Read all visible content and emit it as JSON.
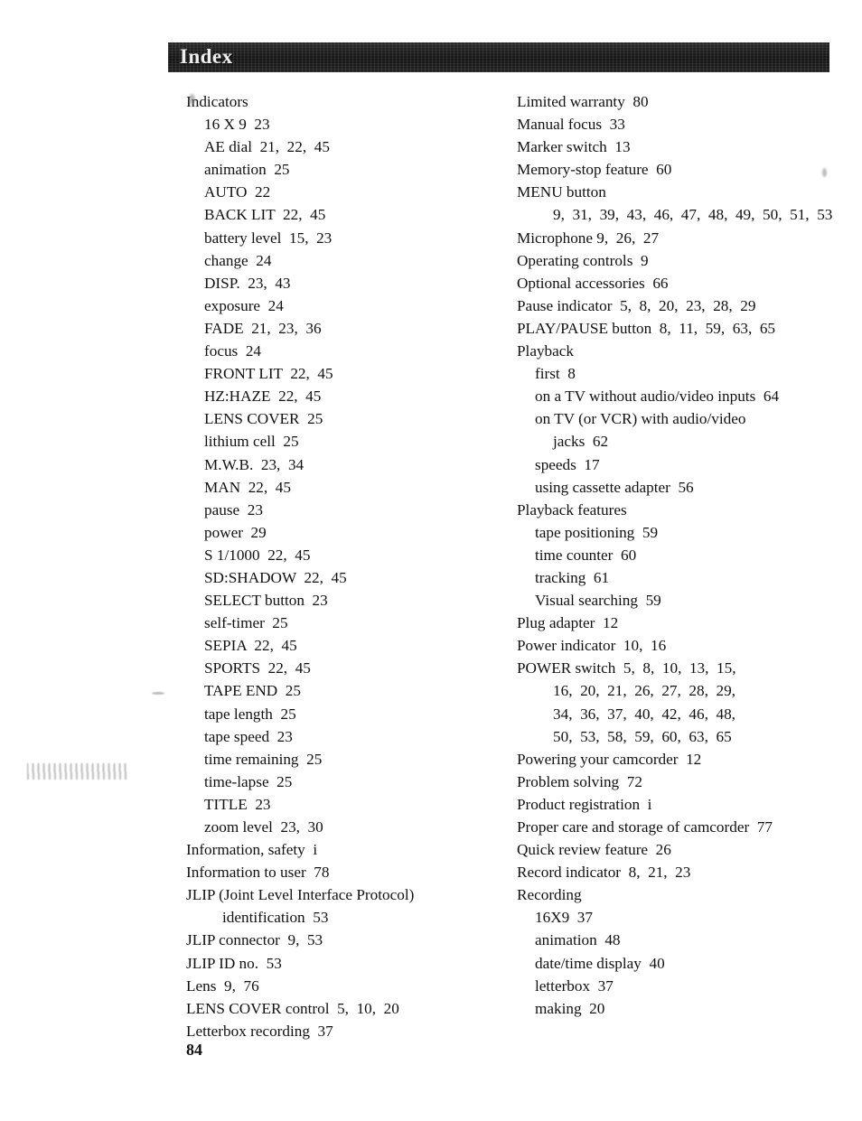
{
  "document": {
    "header_title": "Index",
    "page_number": "84",
    "columns": {
      "left": [
        {
          "level": 0,
          "text": "Indicators"
        },
        {
          "level": 1,
          "text": "16 X 9  23"
        },
        {
          "level": 1,
          "text": "AE dial  21,  22,  45"
        },
        {
          "level": 1,
          "text": "animation  25"
        },
        {
          "level": 1,
          "text": "AUTO  22"
        },
        {
          "level": 1,
          "text": "BACK LIT  22,  45"
        },
        {
          "level": 1,
          "text": "battery level  15,  23"
        },
        {
          "level": 1,
          "text": "change  24"
        },
        {
          "level": 1,
          "text": "DISP.  23,  43"
        },
        {
          "level": 1,
          "text": "exposure  24"
        },
        {
          "level": 1,
          "text": "FADE  21,  23,  36"
        },
        {
          "level": 1,
          "text": "focus  24"
        },
        {
          "level": 1,
          "text": "FRONT LIT  22,  45"
        },
        {
          "level": 1,
          "text": "HZ:HAZE  22,  45"
        },
        {
          "level": 1,
          "text": "LENS COVER  25"
        },
        {
          "level": 1,
          "text": "lithium cell  25"
        },
        {
          "level": 1,
          "text": "M.W.B.  23,  34"
        },
        {
          "level": 1,
          "text": "MAN  22,  45"
        },
        {
          "level": 1,
          "text": "pause  23"
        },
        {
          "level": 1,
          "text": "power  29"
        },
        {
          "level": 1,
          "text": "S 1/1000  22,  45"
        },
        {
          "level": 1,
          "text": "SD:SHADOW  22,  45"
        },
        {
          "level": 1,
          "text": "SELECT button  23"
        },
        {
          "level": 1,
          "text": "self-timer  25"
        },
        {
          "level": 1,
          "text": "SEPIA  22,  45"
        },
        {
          "level": 1,
          "text": "SPORTS  22,  45"
        },
        {
          "level": 1,
          "text": "TAPE END  25"
        },
        {
          "level": 1,
          "text": "tape length  25"
        },
        {
          "level": 1,
          "text": "tape speed  23"
        },
        {
          "level": 1,
          "text": "time remaining  25"
        },
        {
          "level": 1,
          "text": "time-lapse  25"
        },
        {
          "level": 1,
          "text": "TITLE  23"
        },
        {
          "level": 1,
          "text": "zoom level  23,  30"
        },
        {
          "level": 0,
          "text": "Information, safety  i"
        },
        {
          "level": 0,
          "text": "Information to user  78"
        },
        {
          "level": 0,
          "text": "JLIP (Joint Level Interface Protocol)"
        },
        {
          "level": 2,
          "text": "identification  53"
        },
        {
          "level": 0,
          "text": "JLIP connector  9,  53"
        },
        {
          "level": 0,
          "text": "JLIP ID no.  53"
        },
        {
          "level": 0,
          "text": "Lens  9,  76"
        },
        {
          "level": 0,
          "text": "LENS COVER control  5,  10,  20"
        },
        {
          "level": 0,
          "text": "Letterbox recording  37"
        }
      ],
      "right": [
        {
          "level": 0,
          "text": "Limited warranty  80"
        },
        {
          "level": 0,
          "text": "Manual focus  33"
        },
        {
          "level": 0,
          "text": "Marker switch  13"
        },
        {
          "level": 0,
          "text": "Memory-stop feature  60"
        },
        {
          "level": 0,
          "text": "MENU button"
        },
        {
          "level": 2,
          "text": "9,  31,  39,  43,  46,  47,  48,  49,  50,  51,  53"
        },
        {
          "level": 0,
          "text": "Microphone 9,  26,  27"
        },
        {
          "level": 0,
          "text": "Operating controls  9"
        },
        {
          "level": 0,
          "text": "Optional accessories  66"
        },
        {
          "level": 0,
          "text": "Pause indicator  5,  8,  20,  23,  28,  29"
        },
        {
          "level": 0,
          "text": "PLAY/PAUSE button  8,  11,  59,  63,  65"
        },
        {
          "level": 0,
          "text": "Playback"
        },
        {
          "level": 1,
          "text": "first  8"
        },
        {
          "level": 1,
          "text": "on a TV without audio/video inputs  64"
        },
        {
          "level": 1,
          "text": "on TV (or VCR) with audio/video"
        },
        {
          "level": 2,
          "text": "jacks  62"
        },
        {
          "level": 1,
          "text": "speeds  17"
        },
        {
          "level": 1,
          "text": "using cassette adapter  56"
        },
        {
          "level": 0,
          "text": "Playback features"
        },
        {
          "level": 1,
          "text": "tape positioning  59"
        },
        {
          "level": 1,
          "text": "time counter  60"
        },
        {
          "level": 1,
          "text": "tracking  61"
        },
        {
          "level": 1,
          "text": "Visual searching  59"
        },
        {
          "level": 0,
          "text": "Plug adapter  12"
        },
        {
          "level": 0,
          "text": "Power indicator  10,  16"
        },
        {
          "level": 0,
          "text": "POWER switch  5,  8,  10,  13,  15,"
        },
        {
          "level": 2,
          "text": "16,  20,  21,  26,  27,  28,  29,"
        },
        {
          "level": 2,
          "text": "34,  36,  37,  40,  42,  46,  48,"
        },
        {
          "level": 2,
          "text": "50,  53,  58,  59,  60,  63,  65"
        },
        {
          "level": 0,
          "text": "Powering your camcorder  12"
        },
        {
          "level": 0,
          "text": "Problem solving  72"
        },
        {
          "level": 0,
          "text": "Product registration  i"
        },
        {
          "level": 0,
          "text": "Proper care and storage of camcorder  77"
        },
        {
          "level": 0,
          "text": "Quick review feature  26"
        },
        {
          "level": 0,
          "text": "Record indicator  8,  21,  23"
        },
        {
          "level": 0,
          "text": "Recording"
        },
        {
          "level": 1,
          "text": "16X9  37"
        },
        {
          "level": 1,
          "text": "animation  48"
        },
        {
          "level": 1,
          "text": "date/time display  40"
        },
        {
          "level": 1,
          "text": "letterbox  37"
        },
        {
          "level": 1,
          "text": "making  20"
        }
      ]
    }
  }
}
